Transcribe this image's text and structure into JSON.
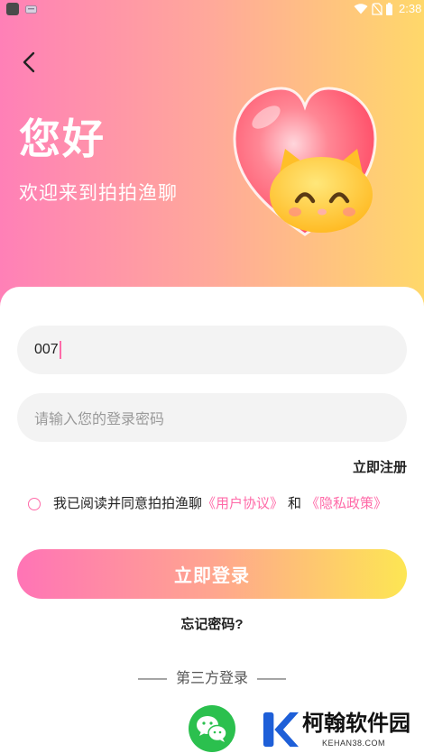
{
  "status_bar": {
    "time": "2:38",
    "icons": [
      "app-notification-icon",
      "game-notification-icon",
      "wifi-icon",
      "no-sim-icon",
      "battery-icon"
    ]
  },
  "header": {
    "back_icon": "chevron-left-icon",
    "greeting": "您好",
    "welcome": "欢迎来到拍拍渔聊",
    "illustration": "heart-cat-illustration"
  },
  "login": {
    "account": {
      "value": "007"
    },
    "password": {
      "placeholder": "请输入您的登录密码"
    },
    "register_link": "立即注册",
    "agreement": {
      "checked": false,
      "prefix": "我已阅读并同意拍拍渔聊",
      "user_agreement": "《用户协议》",
      "conjunction": "和",
      "privacy_policy": "《隐私政策》"
    },
    "login_button": "立即登录",
    "forgot_password": "忘记密码?",
    "third_party": {
      "dash": "——",
      "label": "第三方登录",
      "providers": [
        {
          "icon": "wechat-icon"
        }
      ]
    }
  },
  "watermark": {
    "brand": "柯翰软件园",
    "site": "KEHAN38.COM",
    "logo": "k-logo-icon"
  },
  "colors": {
    "gradient_start": "#ff80b7",
    "gradient_end": "#ffd86a",
    "accent_pink": "#ff6aa8",
    "button_gradient_end": "#fde653",
    "wechat_green": "#2bc04e"
  }
}
